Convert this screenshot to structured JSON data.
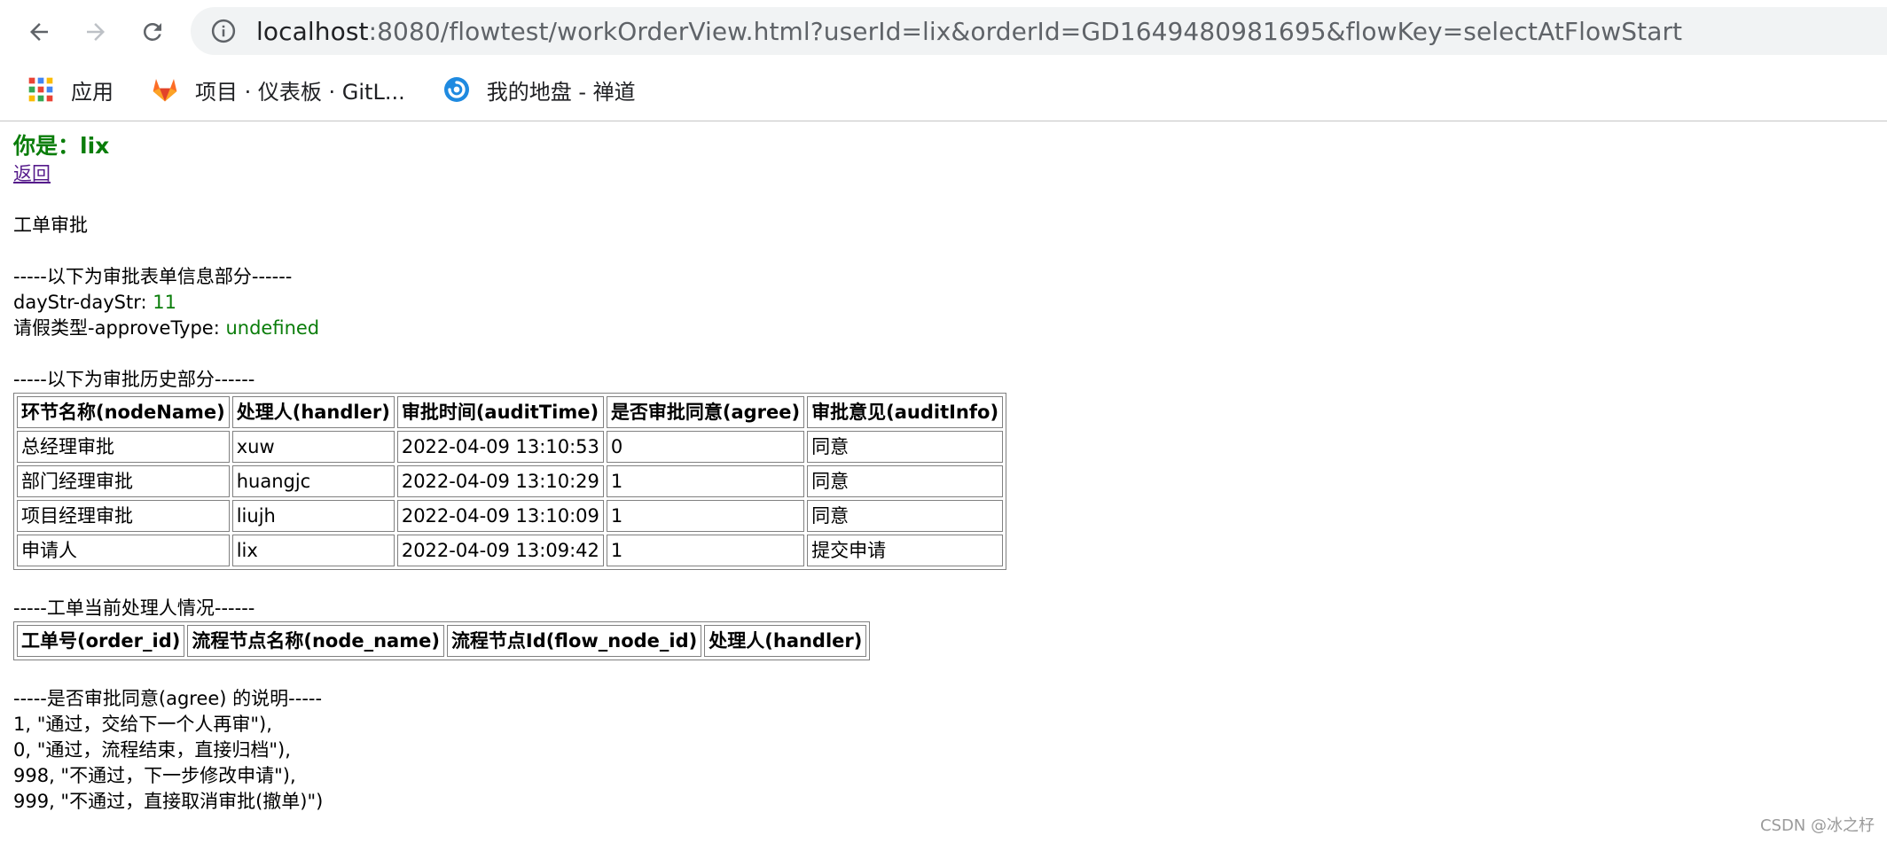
{
  "browser": {
    "url_host": "localhost",
    "url_rest": ":8080/flowtest/workOrderView.html?userId=lix&orderId=GD1649480981695&flowKey=selectAtFlowStart",
    "bookmarks": [
      {
        "label": "应用",
        "icon": "apps-grid-icon"
      },
      {
        "label": "项目 · 仪表板 · GitL...",
        "icon": "gitlab-icon"
      },
      {
        "label": "我的地盘 - 禅道",
        "icon": "zentao-icon"
      }
    ]
  },
  "page": {
    "you_label": "你是：lix",
    "back_link": "返回",
    "title": "工单审批",
    "form_section_header": "-----以下为审批表单信息部分------",
    "form_fields": [
      {
        "label": "dayStr-dayStr: ",
        "value": "11"
      },
      {
        "label": "请假类型-approveType: ",
        "value": "undefined"
      }
    ],
    "history_section_header": "-----以下为审批历史部分------",
    "history_table": {
      "headers": [
        "环节名称(nodeName)",
        "处理人(handler)",
        "审批时间(auditTime)",
        "是否审批同意(agree)",
        "审批意见(auditInfo)"
      ],
      "rows": [
        [
          "总经理审批",
          "xuw",
          "2022-04-09 13:10:53",
          "0",
          "同意"
        ],
        [
          "部门经理审批",
          "huangjc",
          "2022-04-09 13:10:29",
          "1",
          "同意"
        ],
        [
          "项目经理审批",
          "liujh",
          "2022-04-09 13:10:09",
          "1",
          "同意"
        ],
        [
          "申请人",
          "lix",
          "2022-04-09 13:09:42",
          "1",
          "提交申请"
        ]
      ]
    },
    "handler_section_header": "-----工单当前处理人情况------",
    "handler_table": {
      "headers": [
        "工单号(order_id)",
        "流程节点名称(node_name)",
        "流程节点Id(flow_node_id)",
        "处理人(handler)"
      ]
    },
    "agree_section_header": "-----是否审批同意(agree) 的说明-----",
    "agree_notes": [
      "1, \"通过，交给下一个人再审\"),",
      "0, \"通过，流程结束，直接归档\"),",
      "998, \"不通过，下一步修改申请\"),",
      "999, \"不通过，直接取消审批(撤单)\")"
    ],
    "watermark": "CSDN @冰之杍"
  },
  "colors": {
    "accent_green": "#0a7d0a",
    "link_visited": "#551a8b"
  }
}
